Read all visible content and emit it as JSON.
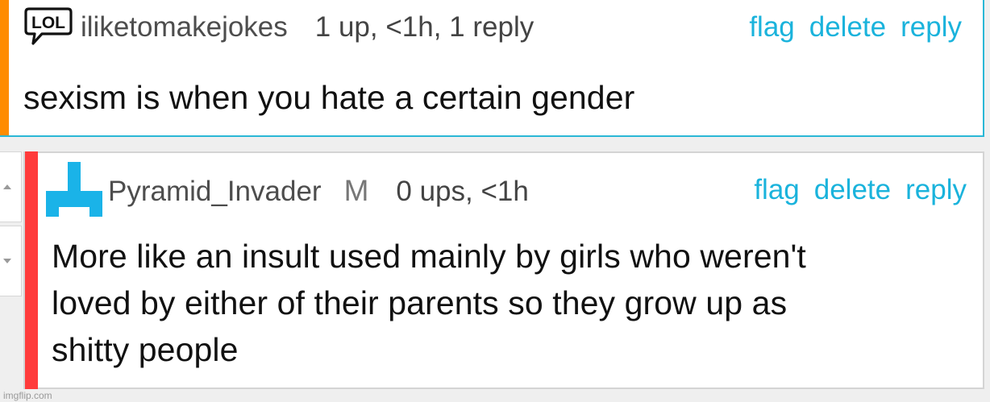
{
  "top_comment": {
    "username": "iliketomakejokes",
    "stats": "1 up, <1h, 1 reply",
    "badge_icon": "lol-speech-bubble-icon",
    "badge_text": "LOL",
    "accent_color": "#ff8c00",
    "actions": {
      "flag": "flag",
      "delete": "delete",
      "reply": "reply"
    },
    "body": "sexism is when you hate a certain gender"
  },
  "reply_comment": {
    "username": "Pyramid_Invader",
    "mod_badge": "M",
    "stats": "0 ups, <1h",
    "avatar_icon": "pyramid-invader-avatar-icon",
    "accent_color": "#ff3b3b",
    "actions": {
      "flag": "flag",
      "delete": "delete",
      "reply": "reply"
    },
    "body_lines": [
      "More like an insult used mainly by girls who weren't",
      "loved by either of their parents so they grow up as",
      "shitty people"
    ]
  },
  "votes": {
    "up_icon": "upvote-arrow-icon",
    "down_icon": "downvote-arrow-icon"
  },
  "watermark": "imgflip.com",
  "colors": {
    "link": "#1ab3dc",
    "highlight_border": "#2ab7d6"
  }
}
